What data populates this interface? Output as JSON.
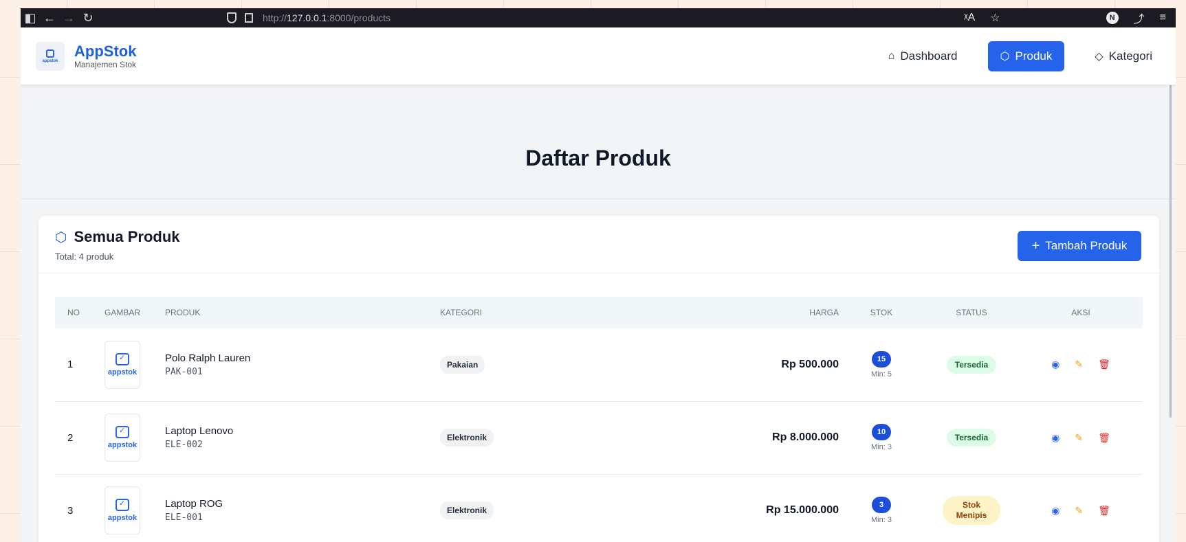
{
  "browser": {
    "url_prefix": "http://",
    "url_host": "127.0.0.1",
    "url_rest": ":8000/products",
    "profile_initial": "N"
  },
  "app": {
    "brand_name": "AppStok",
    "brand_sub": "Manajemen Stok",
    "logo_text": "appstok"
  },
  "nav": {
    "dashboard": "Dashboard",
    "produk": "Produk",
    "kategori": "Kategori"
  },
  "page_title": "Daftar Produk",
  "card": {
    "title": "Semua Produk",
    "total": "Total: 4 produk",
    "add_button": "Tambah Produk"
  },
  "table": {
    "headers": {
      "no": "NO",
      "gambar": "GAMBAR",
      "produk": "PRODUK",
      "kategori": "KATEGORI",
      "harga": "HARGA",
      "stok": "STOK",
      "status": "STATUS",
      "aksi": "AKSI"
    },
    "rows": [
      {
        "no": "1",
        "image_label": "appstok",
        "name": "Polo Ralph Lauren",
        "code": "PAK-001",
        "category": "Pakaian",
        "price": "Rp 500.000",
        "stock": "15",
        "min": "Min: 5",
        "status": "Tersedia",
        "status_level": "ok"
      },
      {
        "no": "2",
        "image_label": "appstok",
        "name": "Laptop Lenovo",
        "code": "ELE-002",
        "category": "Elektronik",
        "price": "Rp 8.000.000",
        "stock": "10",
        "min": "Min: 3",
        "status": "Tersedia",
        "status_level": "ok"
      },
      {
        "no": "3",
        "image_label": "appstok",
        "name": "Laptop ROG",
        "code": "ELE-001",
        "category": "Elektronik",
        "price": "Rp 15.000.000",
        "stock": "3",
        "min": "Min: 3",
        "status_line1": "Stok",
        "status_line2": "Menipis",
        "status_level": "low"
      }
    ]
  },
  "colors": {
    "primary": "#2563eb",
    "ok_bg": "#dcfce7",
    "low_bg": "#fef3c7"
  }
}
